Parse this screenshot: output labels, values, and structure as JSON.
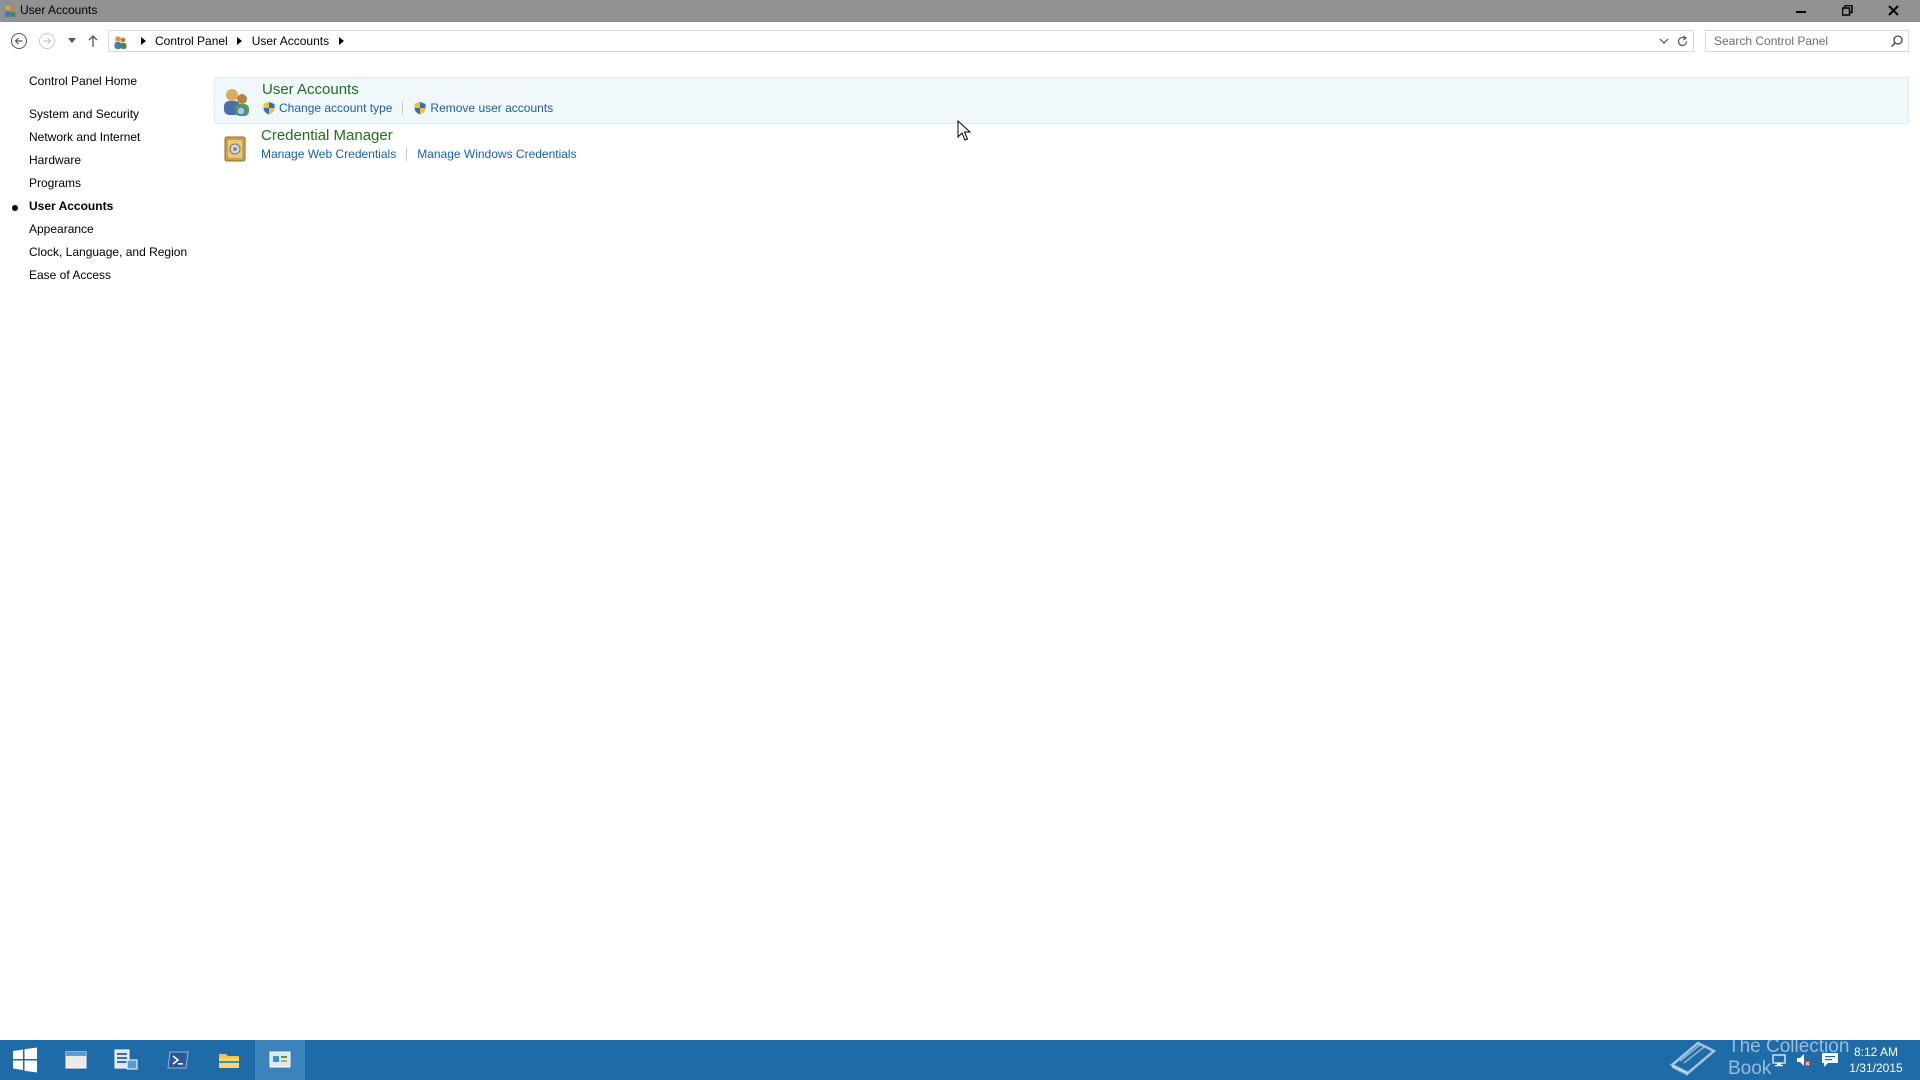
{
  "window": {
    "title": "User Accounts"
  },
  "address_bar": {
    "crumbs": [
      "Control Panel",
      "User Accounts"
    ]
  },
  "search": {
    "placeholder": "Search Control Panel"
  },
  "left_nav": {
    "home": "Control Panel Home",
    "categories": [
      "System and Security",
      "Network and Internet",
      "Hardware",
      "Programs",
      "User Accounts",
      "Appearance",
      "Clock, Language, and Region",
      "Ease of Access"
    ],
    "active_index": 4
  },
  "groups": [
    {
      "title": "User Accounts",
      "links": [
        "Change account type",
        "Remove user accounts"
      ]
    },
    {
      "title": "Credential Manager",
      "links": [
        "Manage Web Credentials",
        "Manage Windows Credentials"
      ]
    }
  ],
  "taskbar": {
    "clock_time": "8:12 AM",
    "clock_date": "1/31/2015",
    "watermark": "The Collection Book"
  },
  "colors": {
    "taskbar": "#1e6ba8",
    "link": "#1a5fa8",
    "group_title": "#1e6f1e",
    "titlebar": "#919191"
  }
}
